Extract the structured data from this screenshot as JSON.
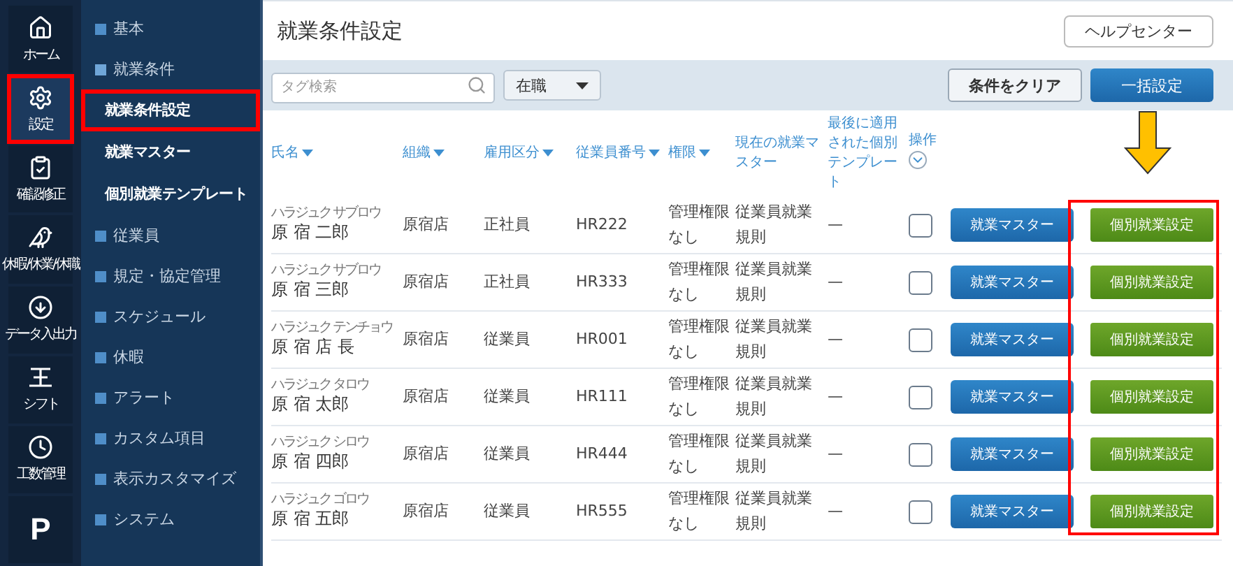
{
  "rail": [
    {
      "label": "ホーム",
      "selected": false,
      "annotated": false
    },
    {
      "label": "設定",
      "selected": true,
      "annotated": true
    },
    {
      "label": "確認修正",
      "selected": false,
      "annotated": false
    },
    {
      "label": "休暇/休業/休職",
      "selected": false,
      "annotated": false
    },
    {
      "label": "データ入出力",
      "selected": false,
      "annotated": false
    },
    {
      "label": "シフト",
      "selected": false,
      "annotated": false
    },
    {
      "label": "工数管理",
      "selected": false,
      "annotated": false
    },
    {
      "glyph": "P",
      "selected": false,
      "annotated": false
    }
  ],
  "subnav": [
    {
      "label": "基本",
      "expanded": false
    },
    {
      "label": "就業条件",
      "expanded": true,
      "children": [
        {
          "label": "就業条件設定",
          "selected": true,
          "annotated": true
        },
        {
          "label": "就業マスター",
          "selected": false,
          "annotated": false
        },
        {
          "label": "個別就業テンプレート",
          "selected": false,
          "annotated": false
        }
      ]
    },
    {
      "label": "従業員",
      "expanded": false
    },
    {
      "label": "規定・協定管理",
      "expanded": false
    },
    {
      "label": "スケジュール",
      "expanded": false
    },
    {
      "label": "休暇",
      "expanded": false
    },
    {
      "label": "アラート",
      "expanded": false
    },
    {
      "label": "カスタム項目",
      "expanded": false
    },
    {
      "label": "表示カスタマイズ",
      "expanded": false
    },
    {
      "label": "システム",
      "expanded": false
    }
  ],
  "page_title": "就業条件設定",
  "help_button": "ヘルプセンター",
  "filters": {
    "search": {
      "placeholder": "タグ検索"
    },
    "status": "在職",
    "clear_button": "条件をクリア",
    "bulk_button": "一括設定"
  },
  "table": {
    "columns": [
      {
        "label": "氏名",
        "sortable": true
      },
      {
        "label": "組織",
        "sortable": true
      },
      {
        "label": "雇用区分",
        "sortable": true
      },
      {
        "label": "従業員番号",
        "sortable": true
      },
      {
        "label": "権限",
        "sortable": true
      },
      {
        "label": "現在の就業マスター",
        "sortable": false
      },
      {
        "label": "最後に適用された個別テンプレート",
        "sortable": false
      },
      {
        "label": "操作",
        "sortable": false
      }
    ],
    "action_column_annotated": true,
    "rows": [
      {
        "ruby": "ハラジュク サブロウ",
        "name": "原 宿 二郎",
        "org": "原宿店",
        "type": "正社員",
        "number": "HR222",
        "role": "管理権限なし",
        "master": "従業員就業規則",
        "template": "—",
        "checked": false,
        "master_button": "就業マスター",
        "personal_button": "個別就業設定"
      },
      {
        "ruby": "ハラジュク サブロウ",
        "name": "原 宿 三郎",
        "org": "原宿店",
        "type": "正社員",
        "number": "HR333",
        "role": "管理権限なし",
        "master": "従業員就業規則",
        "template": "—",
        "checked": false,
        "master_button": "就業マスター",
        "personal_button": "個別就業設定"
      },
      {
        "ruby": "ハラジュク テンチョウ",
        "name": "原 宿 店 長",
        "org": "原宿店",
        "type": "従業員",
        "number": "HR001",
        "role": "管理権限なし",
        "master": "従業員就業規則",
        "template": "—",
        "checked": false,
        "master_button": "就業マスター",
        "personal_button": "個別就業設定"
      },
      {
        "ruby": "ハラジュク タロウ",
        "name": "原 宿 太郎",
        "org": "原宿店",
        "type": "従業員",
        "number": "HR111",
        "role": "管理権限なし",
        "master": "従業員就業規則",
        "template": "—",
        "checked": false,
        "master_button": "就業マスター",
        "personal_button": "個別就業設定"
      },
      {
        "ruby": "ハラジュク シロウ",
        "name": "原 宿 四郎",
        "org": "原宿店",
        "type": "従業員",
        "number": "HR444",
        "role": "管理権限なし",
        "master": "従業員就業規則",
        "template": "—",
        "checked": false,
        "master_button": "就業マスター",
        "personal_button": "個別就業設定"
      },
      {
        "ruby": "ハラジュク ゴロウ",
        "name": "原 宿 五郎",
        "org": "原宿店",
        "type": "従業員",
        "number": "HR555",
        "role": "管理権限なし",
        "master": "従業員就業規則",
        "template": "—",
        "checked": false,
        "master_button": "就業マスター",
        "personal_button": "個別就業設定"
      }
    ]
  }
}
